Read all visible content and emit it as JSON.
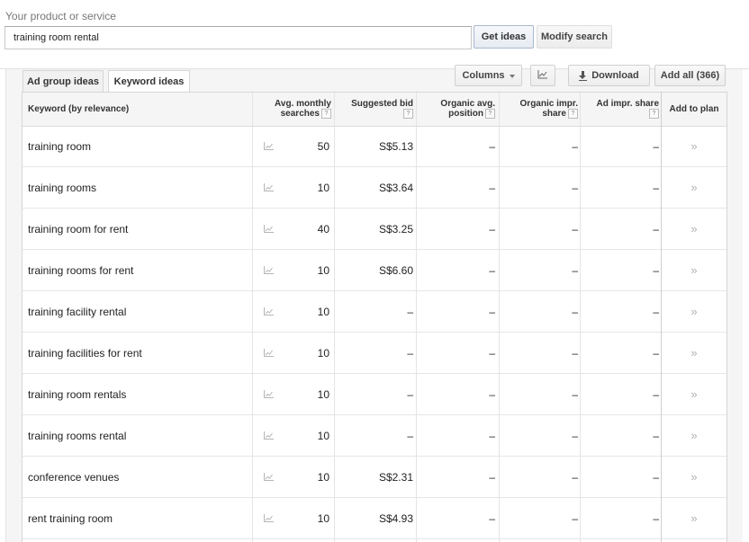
{
  "search": {
    "label": "Your product or service",
    "value": "training room rental",
    "get_ideas_label": "Get ideas",
    "modify_search_label": "Modify search"
  },
  "tabs": [
    {
      "label": "Ad group ideas",
      "active": false
    },
    {
      "label": "Keyword ideas",
      "active": true
    }
  ],
  "toolbar": {
    "columns_label": "Columns",
    "chart_icon": "line-chart-icon",
    "download_label": "Download",
    "add_all_label": "Add all (366)"
  },
  "table": {
    "headers": {
      "keyword": "Keyword (by relevance)",
      "avg_line1": "Avg. monthly",
      "avg_line2": "searches",
      "bid": "Suggested bid",
      "org_line1": "Organic avg.",
      "org_line2": "position",
      "orgsh_line1": "Organic impr.",
      "orgsh_line2": "share",
      "adsh": "Ad impr. share",
      "add": "Add to plan",
      "help_mark": "?"
    },
    "rows": [
      {
        "keyword": "training room",
        "avg": "50",
        "bid": "S$5.13",
        "org": "–",
        "orgsh": "–",
        "adsh": "–",
        "add": "»"
      },
      {
        "keyword": "training rooms",
        "avg": "10",
        "bid": "S$3.64",
        "org": "–",
        "orgsh": "–",
        "adsh": "–",
        "add": "»"
      },
      {
        "keyword": "training room for rent",
        "avg": "40",
        "bid": "S$3.25",
        "org": "–",
        "orgsh": "–",
        "adsh": "–",
        "add": "»"
      },
      {
        "keyword": "training rooms for rent",
        "avg": "10",
        "bid": "S$6.60",
        "org": "–",
        "orgsh": "–",
        "adsh": "–",
        "add": "»"
      },
      {
        "keyword": "training facility rental",
        "avg": "10",
        "bid": "–",
        "org": "–",
        "orgsh": "–",
        "adsh": "–",
        "add": "»"
      },
      {
        "keyword": "training facilities for rent",
        "avg": "10",
        "bid": "–",
        "org": "–",
        "orgsh": "–",
        "adsh": "–",
        "add": "»"
      },
      {
        "keyword": "training room rentals",
        "avg": "10",
        "bid": "–",
        "org": "–",
        "orgsh": "–",
        "adsh": "–",
        "add": "»"
      },
      {
        "keyword": "training rooms rental",
        "avg": "10",
        "bid": "–",
        "org": "–",
        "orgsh": "–",
        "adsh": "–",
        "add": "»"
      },
      {
        "keyword": "conference venues",
        "avg": "10",
        "bid": "S$2.31",
        "org": "–",
        "orgsh": "–",
        "adsh": "–",
        "add": "»"
      },
      {
        "keyword": "rent training room",
        "avg": "10",
        "bid": "S$4.93",
        "org": "–",
        "orgsh": "–",
        "adsh": "–",
        "add": "»"
      }
    ]
  },
  "colors": {
    "border": "#d6d6d6",
    "header_bg": "#f5f5f5",
    "panel_bg": "#f5f5f5",
    "icon_gray": "#b0b0b0"
  }
}
